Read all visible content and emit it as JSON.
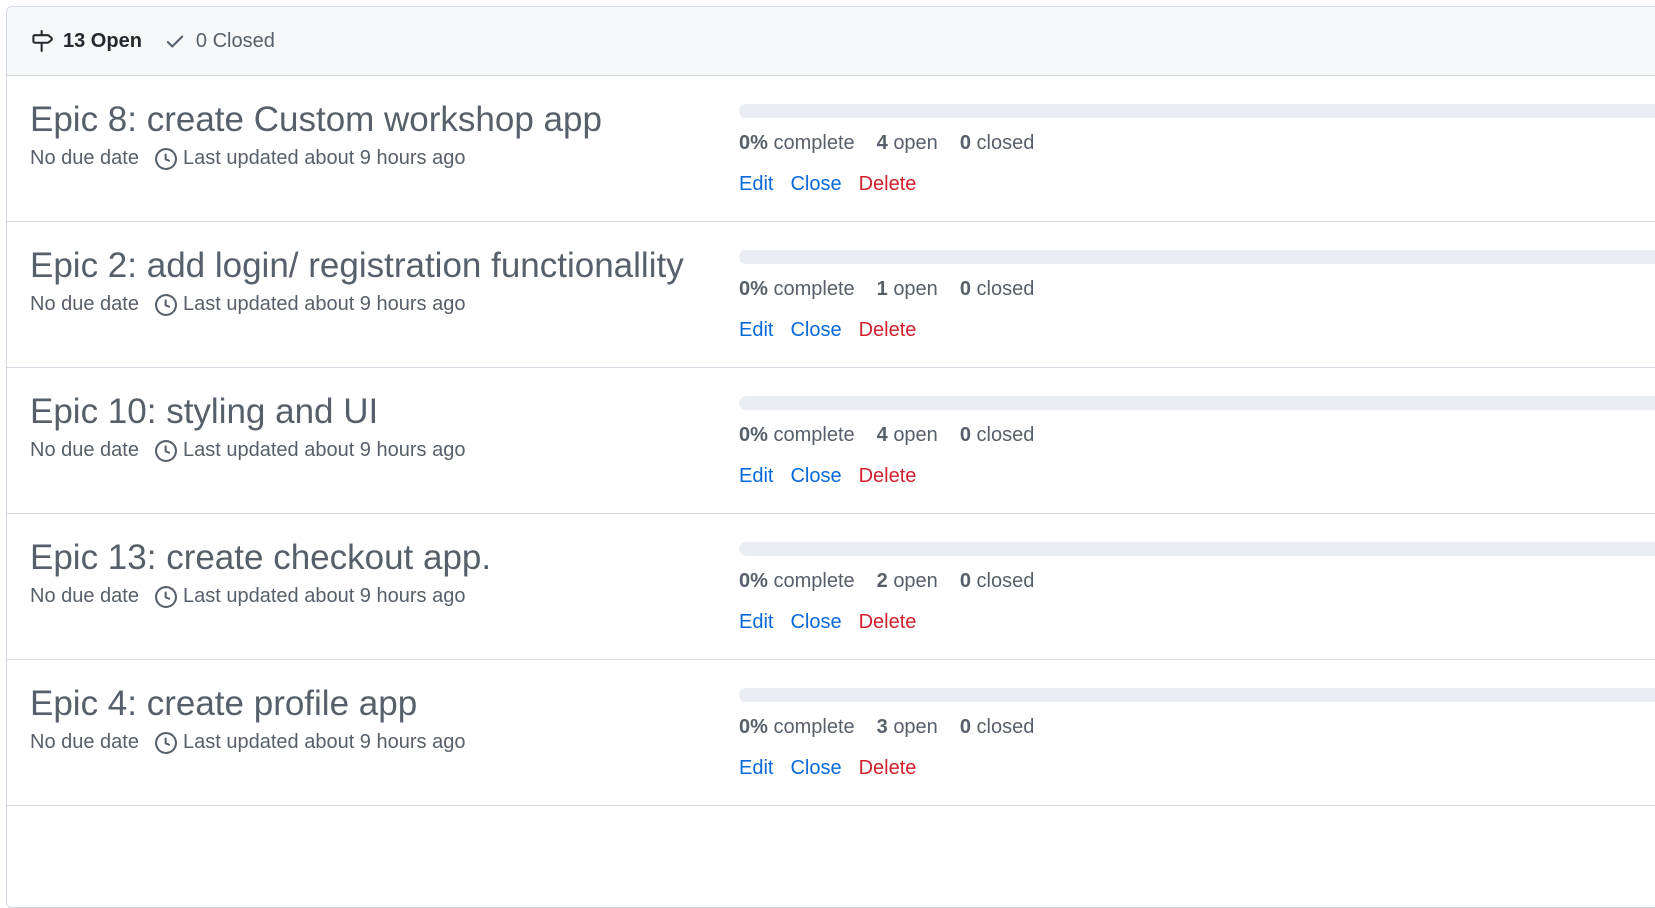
{
  "filter": {
    "open_label": "13 Open",
    "closed_label": "0 Closed"
  },
  "milestones": [
    {
      "title": "Epic 8: create Custom workshop app",
      "due": "No due date",
      "updated": "Last updated about 9 hours ago",
      "percent": "0%",
      "percent_label": "complete",
      "progress": 0,
      "open": "4",
      "open_label": "open",
      "closed": "0",
      "closed_label": "closed",
      "edit": "Edit",
      "close": "Close",
      "delete": "Delete"
    },
    {
      "title": "Epic 2: add login/ registration functionallity",
      "due": "No due date",
      "updated": "Last updated about 9 hours ago",
      "percent": "0%",
      "percent_label": "complete",
      "progress": 0,
      "open": "1",
      "open_label": "open",
      "closed": "0",
      "closed_label": "closed",
      "edit": "Edit",
      "close": "Close",
      "delete": "Delete"
    },
    {
      "title": "Epic 10: styling and UI",
      "due": "No due date",
      "updated": "Last updated about 9 hours ago",
      "percent": "0%",
      "percent_label": "complete",
      "progress": 0,
      "open": "4",
      "open_label": "open",
      "closed": "0",
      "closed_label": "closed",
      "edit": "Edit",
      "close": "Close",
      "delete": "Delete"
    },
    {
      "title": "Epic 13: create checkout app.",
      "due": "No due date",
      "updated": "Last updated about 9 hours ago",
      "percent": "0%",
      "percent_label": "complete",
      "progress": 0,
      "open": "2",
      "open_label": "open",
      "closed": "0",
      "closed_label": "closed",
      "edit": "Edit",
      "close": "Close",
      "delete": "Delete"
    },
    {
      "title": "Epic 4: create profile app",
      "due": "No due date",
      "updated": "Last updated about 9 hours ago",
      "percent": "0%",
      "percent_label": "complete",
      "progress": 0,
      "open": "3",
      "open_label": "open",
      "closed": "0",
      "closed_label": "closed",
      "edit": "Edit",
      "close": "Close",
      "delete": "Delete"
    }
  ],
  "icons": {
    "open": "milestone-icon",
    "closed": "check-icon",
    "updated": "clock-icon"
  },
  "colors": {
    "link": "#0969da",
    "danger": "#cf222e",
    "muted": "#57606a",
    "header_bg": "#f6f8fa",
    "border": "#d0d7de",
    "progress_track": "#eaeef2",
    "progress_fill": "#1f883d"
  }
}
